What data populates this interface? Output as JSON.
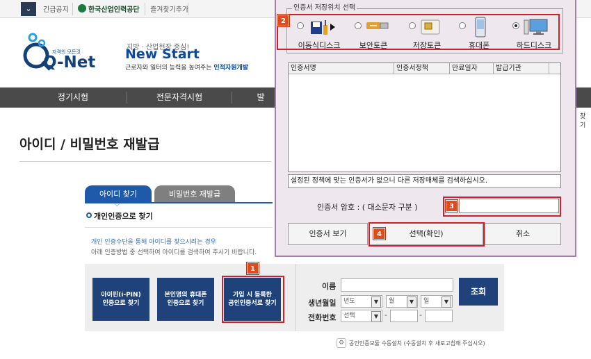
{
  "topbar": {
    "menu_icon": "chevron-down-icon",
    "notice": "긴급공지",
    "org_name": "한국산업인력공단",
    "favorites": "즐겨찾기추가"
  },
  "logo": {
    "small_text": "자격의 모든것",
    "name": "Q-Net",
    "slogan_top": "지방 · 산업현장 중심!",
    "slogan_main": "New Start",
    "slogan_sub_prefix": "근로자와 일터의 능력을 높여주는",
    "slogan_sub_emph": "인적자원개발"
  },
  "nav": {
    "items": [
      "정기시험",
      "전문자격시험",
      "발"
    ]
  },
  "side_text": "찾기",
  "page": {
    "title": "아이디 / 비밀번호 재발급",
    "tabs": [
      "아이디 찾기",
      "비밀번호 재발급"
    ],
    "subhead": "개인인증으로 찾기",
    "info_line1": "개인 인증수단을 통해 아이디를 찾으시려는 경우",
    "info_line2": "아래 인증방법 중 선택하여 아이디를 검색하여 주시기 바랍니다."
  },
  "methods": [
    {
      "line1": "아이핀(i-PIN)",
      "line2": "인증으로 찾기"
    },
    {
      "line1": "본인명의 휴대폰",
      "line2": "인증으로 찾기"
    },
    {
      "line1": "가입 시 등록한",
      "line2": "공인인증서로 찾기"
    }
  ],
  "form": {
    "name_label": "이름",
    "birth_label": "생년월일",
    "year": "년도",
    "month": "월",
    "day": "일",
    "phone_label": "전화번호",
    "phone_select": "선택",
    "dash": "-",
    "lookup_button": "조회"
  },
  "install_note": "공인인증모듈 수동설치 (수동설치 후 새로고침해 주십시오)",
  "markers": {
    "m1": "1",
    "m2": "2",
    "m3": "3",
    "m4": "4"
  },
  "dialog": {
    "group_label": "인증서 저장위치 선택",
    "devices": [
      {
        "label": "이동식디스크",
        "icon": "usb-disk-icon",
        "selected": false
      },
      {
        "label": "보안토큰",
        "icon": "security-token-icon",
        "selected": false
      },
      {
        "label": "저장토큰",
        "icon": "smart-card-icon",
        "selected": false
      },
      {
        "label": "휴대폰",
        "icon": "mobile-phone-icon",
        "selected": false
      },
      {
        "label": "하드디스크",
        "icon": "computer-icon",
        "selected": true
      }
    ],
    "columns": [
      "인증서명",
      "인증서정책",
      "만료일자",
      "발급기관"
    ],
    "status": "설정된 정책에 맞는 인증서가 없으니 다른 저장매체를 검색하십시오.",
    "password_label": "인증서 암호 : ( 대소문자 구분 )",
    "view_button": "인증서 보기",
    "confirm_button": "선택(확인)",
    "cancel_button": "취소"
  },
  "colors": {
    "brand_blue": "#1f5aa8",
    "dark_navy": "#20427a",
    "highlight_red": "#d0202a",
    "marker_orange": "#e04a1c"
  }
}
